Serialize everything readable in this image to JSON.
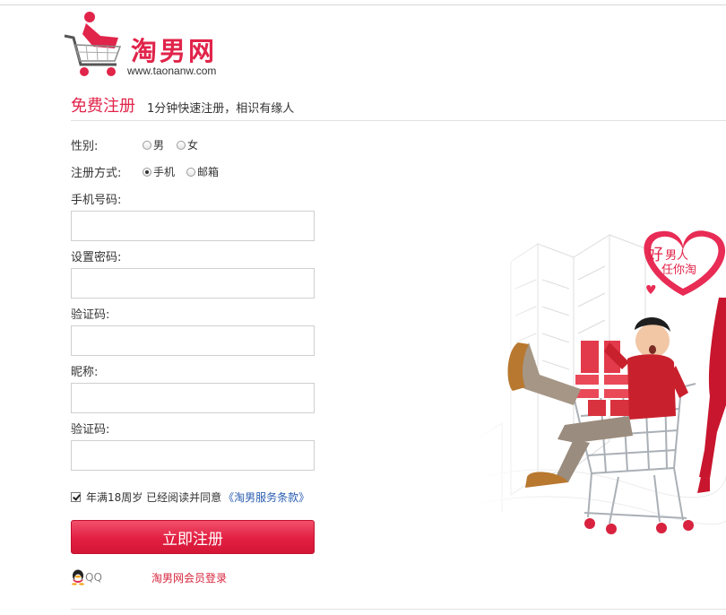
{
  "logo": {
    "name": "淘男网",
    "url": "www.taonanw.com"
  },
  "header": {
    "title": "免费注册",
    "subtitle": "1分钟快速注册，相识有缘人"
  },
  "form": {
    "gender": {
      "label": "性别:",
      "options": [
        "男",
        "女"
      ],
      "selected": null
    },
    "method": {
      "label": "注册方式:",
      "options": [
        "手机",
        "邮箱"
      ],
      "selected": "手机"
    },
    "phone": {
      "label": "手机号码:",
      "value": ""
    },
    "password": {
      "label": "设置密码:",
      "value": ""
    },
    "captcha": {
      "label": "验证码:",
      "value": ""
    },
    "nickname": {
      "label": "昵称:",
      "value": ""
    },
    "captcha2": {
      "label": "验证码:",
      "value": ""
    },
    "agree": {
      "checked": true,
      "text": "年满18周岁 已经阅读并同意",
      "terms": "《淘男服务条款》"
    },
    "submit_label": "立即注册"
  },
  "social": {
    "qq_label": "QQ",
    "member_login": "淘男网会员登录"
  },
  "promo": {
    "line1": "好",
    "line2": "男人",
    "line3": "任你淘"
  },
  "colors": {
    "brand": "#e1244a",
    "link": "#2a5db0"
  }
}
